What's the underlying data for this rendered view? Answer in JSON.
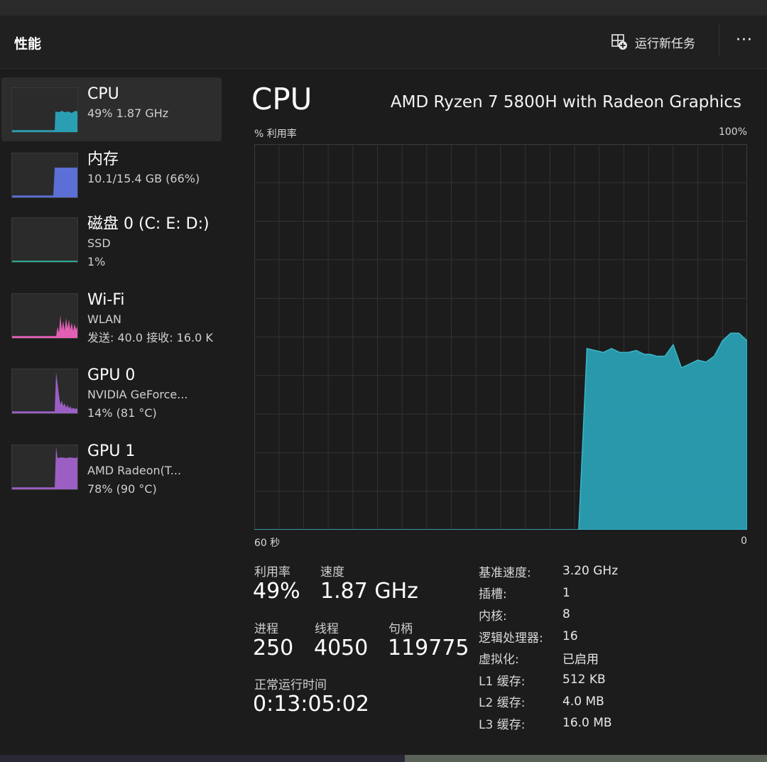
{
  "header": {
    "title": "性能",
    "run_task_label": "运行新任务",
    "more_label": "···"
  },
  "sidebar": {
    "items": [
      {
        "name": "CPU",
        "line1": "49% 1.87 GHz",
        "line2": "",
        "color": "#2a9fb3"
      },
      {
        "name": "内存",
        "line1": "10.1/15.4 GB (66%)",
        "line2": "",
        "color": "#5b6fd6"
      },
      {
        "name": "磁盘 0 (C: E: D:)",
        "line1": "SSD",
        "line2": "1%",
        "color": "#2aa891"
      },
      {
        "name": "Wi-Fi",
        "line1": "WLAN",
        "line2": "发送: 40.0 接收: 16.0 K",
        "color": "#e25fb3"
      },
      {
        "name": "GPU 0",
        "line1": "NVIDIA GeForce...",
        "line2": "14% (81 °C)",
        "color": "#9b5fc4"
      },
      {
        "name": "GPU 1",
        "line1": "AMD Radeon(T...",
        "line2": "78% (90 °C)",
        "color": "#9b5fc4"
      }
    ]
  },
  "main": {
    "title": "CPU",
    "cpu_model": "AMD Ryzen 7 5800H with Radeon Graphics",
    "axis": {
      "y_label": "% 利用率",
      "y_max_label": "100%",
      "x_left_label": "60 秒",
      "x_right_label": "0"
    },
    "stats": {
      "utilization_label": "利用率",
      "utilization_value": "49%",
      "speed_label": "速度",
      "speed_value": "1.87 GHz",
      "processes_label": "进程",
      "processes_value": "250",
      "threads_label": "线程",
      "threads_value": "4050",
      "handles_label": "句柄",
      "handles_value": "119775",
      "uptime_label": "正常运行时间",
      "uptime_value": "0:13:05:02"
    },
    "specs": [
      {
        "key": "基准速度:",
        "value": "3.20 GHz"
      },
      {
        "key": "插槽:",
        "value": "1"
      },
      {
        "key": "内核:",
        "value": "8"
      },
      {
        "key": "逻辑处理器:",
        "value": "16"
      },
      {
        "key": "虚拟化:",
        "value": "已启用"
      },
      {
        "key": "L1 缓存:",
        "value": "512 KB"
      },
      {
        "key": "L2 缓存:",
        "value": "4.0 MB"
      },
      {
        "key": "L3 缓存:",
        "value": "16.0 MB"
      }
    ]
  },
  "chart_data": {
    "type": "area",
    "x_range_seconds": [
      60,
      0
    ],
    "ylim": [
      0,
      100
    ],
    "grid": true,
    "color": "#2a9fb3",
    "x": [
      60,
      21,
      20.5,
      19.5,
      18.5,
      17.5,
      16.5,
      15.5,
      14.5,
      13.5,
      12.5,
      11.8,
      11,
      10,
      9,
      8,
      7,
      6,
      5,
      4,
      3,
      2,
      1,
      0
    ],
    "values": [
      0,
      0,
      0,
      47,
      46.5,
      46,
      47,
      46,
      46,
      46.5,
      45.5,
      45.5,
      45,
      45,
      48,
      42,
      43,
      44,
      43.5,
      45,
      49,
      51,
      51,
      49
    ]
  }
}
